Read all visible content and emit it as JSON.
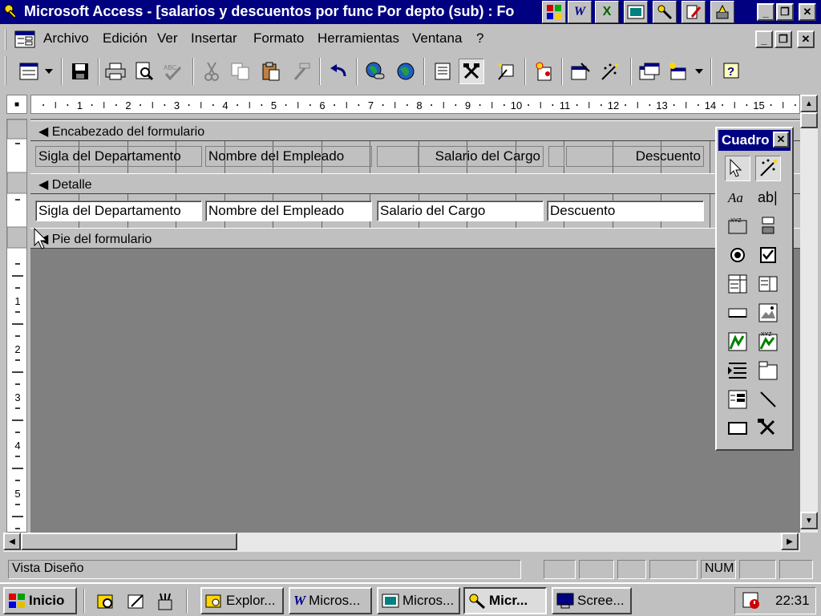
{
  "window": {
    "title": "Microsoft Access - [salarios y descuentos por func Por depto (sub) : Fo",
    "quick_icons": [
      "access-icon",
      "word-icon",
      "excel-icon",
      "powerpoint-icon",
      "access-key-icon",
      "pen-icon",
      "setup-icon"
    ]
  },
  "menu": {
    "items": [
      "Archivo",
      "Edición",
      "Ver",
      "Insertar",
      "Formato",
      "Herramientas",
      "Ventana",
      "?"
    ]
  },
  "toolbar": {
    "icons": [
      "form-view-icon",
      "dropdown-icon",
      "save-icon",
      "print-icon",
      "print-preview-icon",
      "spelling-icon",
      "cut-icon",
      "copy-icon",
      "paste-icon",
      "format-painter-icon",
      "undo-icon",
      "insert-hyperlink-icon",
      "web-toolbar-icon",
      "field-list-icon",
      "toolbox-icon",
      "autoformat-icon",
      "code-icon",
      "properties-icon",
      "build-icon",
      "database-window-icon",
      "new-object-icon",
      "help-icon"
    ]
  },
  "ruler": {
    "numbers": [
      "1",
      "2",
      "3",
      "4",
      "5",
      "6",
      "7",
      "8",
      "9",
      "10",
      "11",
      "12",
      "13",
      "14",
      "15"
    ],
    "vertical_numbers": [
      "1",
      "2",
      "3",
      "4",
      "5"
    ]
  },
  "form": {
    "header_section": "Encabezado del formulario",
    "detail_section": "Detalle",
    "footer_section": "Pie del formulario",
    "header_labels": [
      "Sigla del Departamento",
      "Nombre del Empleado",
      "",
      "Salario del Cargo",
      "",
      "Descuento"
    ],
    "detail_fields": [
      "Sigla del Departamento",
      "Nombre del Empleado",
      "Salario del Cargo",
      "Descuento"
    ]
  },
  "toolbox": {
    "title": "Cuadro",
    "tools": [
      "select-objects-icon",
      "control-wizards-icon",
      "label-tool-icon",
      "textbox-tool-icon",
      "option-group-icon",
      "toggle-button-icon",
      "option-button-icon",
      "checkbox-icon",
      "combo-box-icon",
      "list-box-icon",
      "command-button-icon",
      "image-tool-icon",
      "unbound-object-icon",
      "bound-object-icon",
      "page-break-icon",
      "tab-control-icon",
      "subform-icon",
      "line-tool-icon",
      "rectangle-tool-icon",
      "more-controls-icon"
    ]
  },
  "status": {
    "text": "Vista Diseño",
    "num": "NUM"
  },
  "taskbar": {
    "start": "Inicio",
    "tasks": [
      "Explor...",
      "Micros...",
      "Micros...",
      "Micr...",
      "Scree..."
    ],
    "time": "22:31"
  },
  "colors": {
    "titlebar": "#000080",
    "canvas": "#808080",
    "face": "#c0c0c0"
  }
}
